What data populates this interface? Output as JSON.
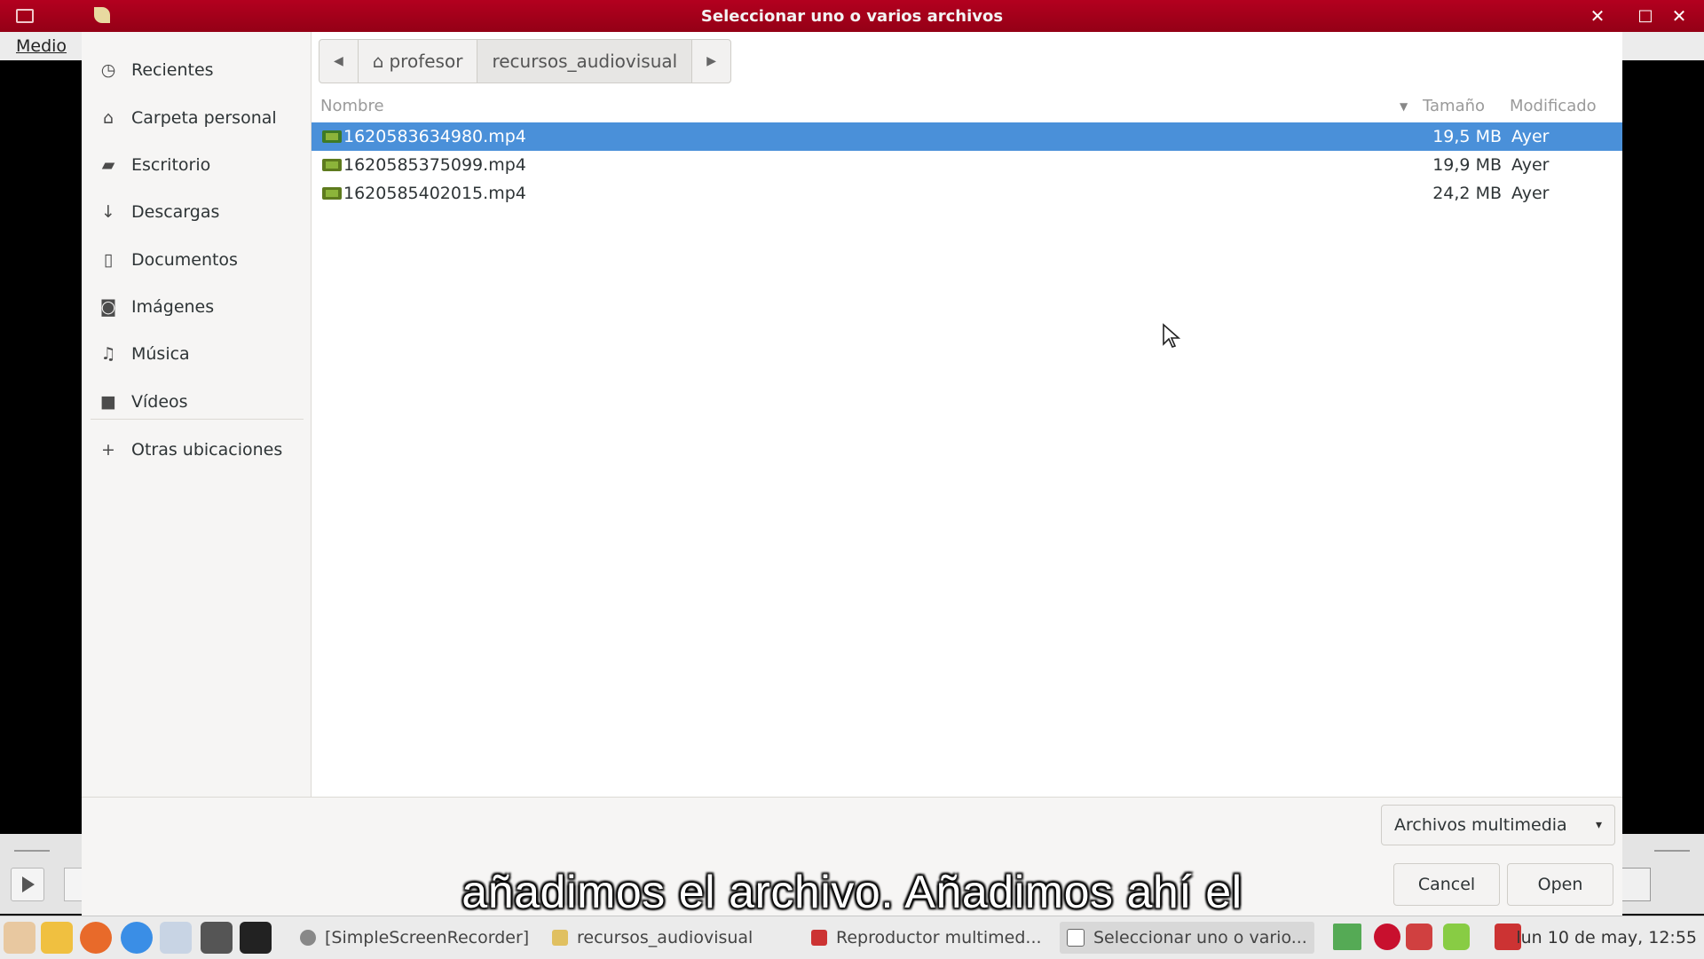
{
  "window": {
    "title": "Seleccionar uno o varios archivos",
    "close_glyph": "✕",
    "max_glyph": "□",
    "close2_glyph": "✕"
  },
  "background_app": {
    "menu_label": "Medio"
  },
  "sidebar": {
    "items": [
      {
        "label": "Recientes",
        "icon": "clock-icon",
        "glyph": "◷"
      },
      {
        "label": "Carpeta personal",
        "icon": "home-icon",
        "glyph": "⌂"
      },
      {
        "label": "Escritorio",
        "icon": "folder-icon",
        "glyph": "▰"
      },
      {
        "label": "Descargas",
        "icon": "download-icon",
        "glyph": "↓"
      },
      {
        "label": "Documentos",
        "icon": "document-icon",
        "glyph": "▯"
      },
      {
        "label": "Imágenes",
        "icon": "camera-icon",
        "glyph": "◙"
      },
      {
        "label": "Música",
        "icon": "music-icon",
        "glyph": "♫"
      },
      {
        "label": "Vídeos",
        "icon": "video-icon",
        "glyph": "■"
      }
    ],
    "other_locations": {
      "label": "Otras ubicaciones",
      "icon": "plus-icon",
      "glyph": "+"
    }
  },
  "pathbar": {
    "back_glyph": "◀",
    "home_glyph": "⌂",
    "segments": [
      "profesor",
      "recursos_audiovisual"
    ],
    "forward_glyph": "▶"
  },
  "columns": {
    "name": "Nombre",
    "size": "Tamaño",
    "modified": "Modificado",
    "sort_glyph": "▼"
  },
  "files": [
    {
      "name": "1620583634980.mp4",
      "size": "19,5 MB",
      "modified": "Ayer",
      "selected": true
    },
    {
      "name": "1620585375099.mp4",
      "size": "19,9 MB",
      "modified": "Ayer",
      "selected": false
    },
    {
      "name": "1620585402015.mp4",
      "size": "24,2 MB",
      "modified": "Ayer",
      "selected": false
    }
  ],
  "footer": {
    "filter_label": "Archivos multimedia",
    "filter_glyph": "▾",
    "cancel_label": "Cancel",
    "open_label": "Open"
  },
  "subtitle": "añadimos el archivo. Añadimos ahí el",
  "taskbar": {
    "tasks": [
      {
        "label": "[SimpleScreenRecorder]",
        "color": "#888888"
      },
      {
        "label": "recursos_audiovisual",
        "color": "#e0c060"
      },
      {
        "label": "Reproductor multimed...",
        "color": "#cc3333"
      },
      {
        "label": "Seleccionar uno o vario...",
        "color": "#666666"
      }
    ],
    "clock": "lun 10 de may, 12:55"
  },
  "colors": {
    "titlebar": "#a1001a",
    "selection": "#4a90d9"
  }
}
